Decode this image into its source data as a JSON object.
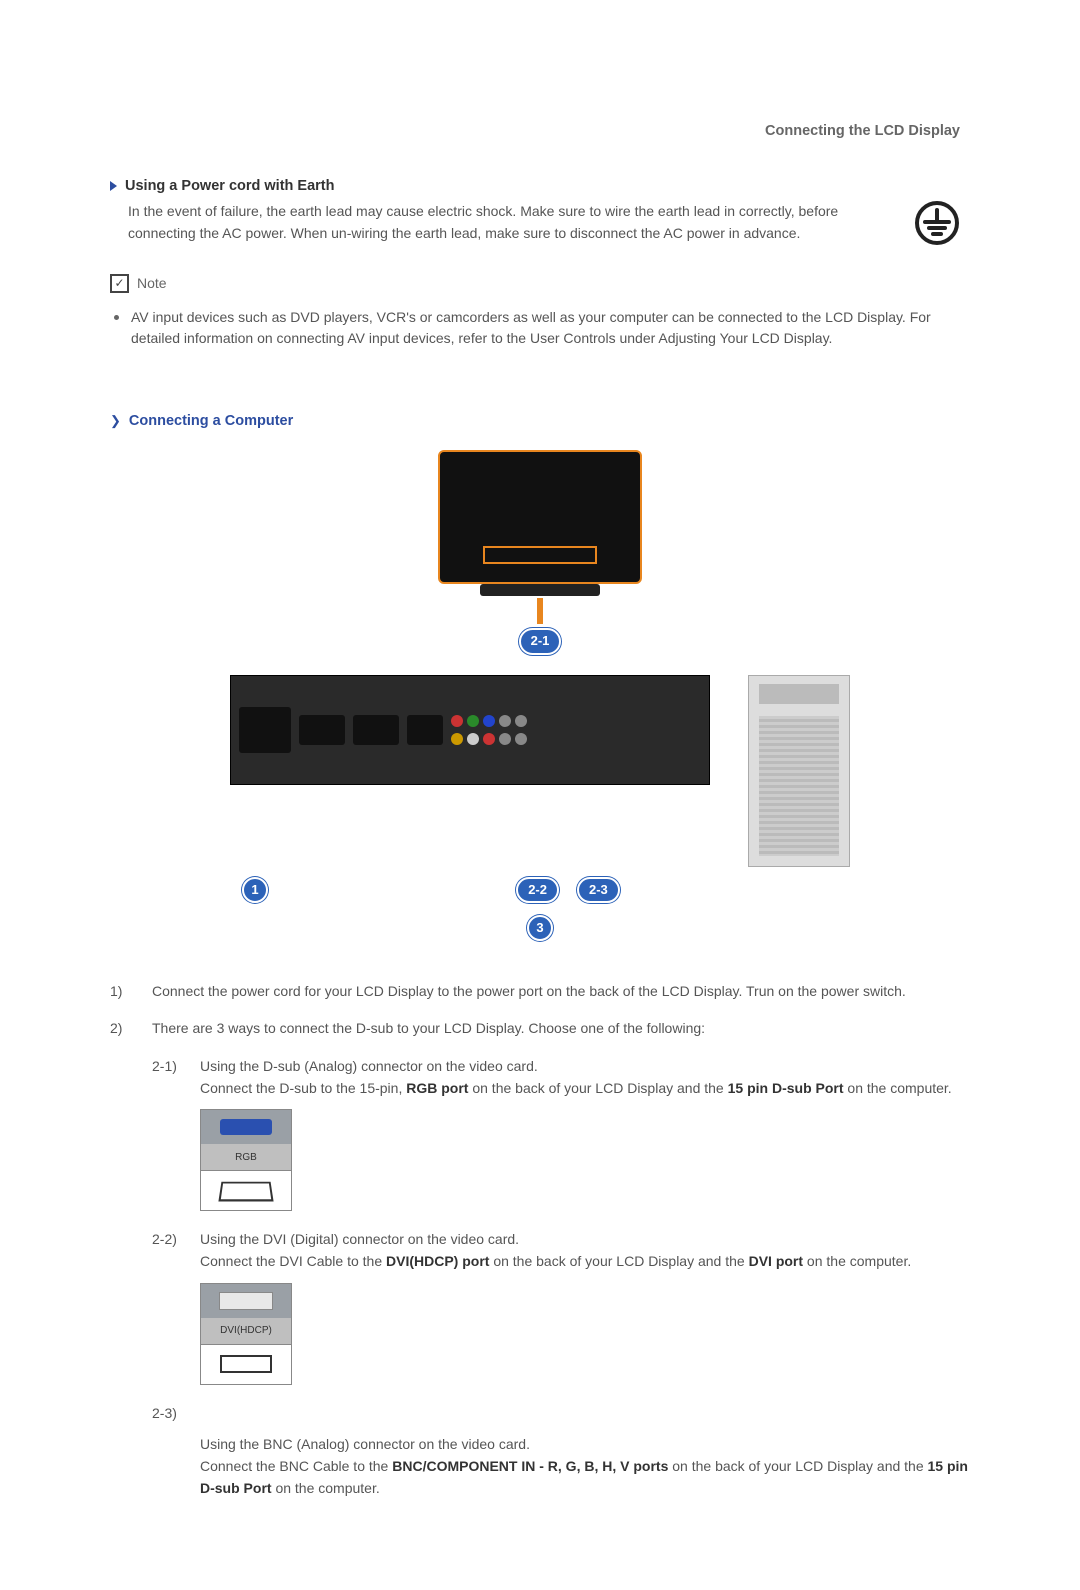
{
  "header": {
    "title": "Connecting the LCD Display"
  },
  "section_earth": {
    "title": "Using a Power cord with Earth",
    "body": "In the event of failure, the earth lead may cause electric shock. Make sure to wire the earth lead in correctly, before connecting the AC power. When un-wiring the earth lead, make sure to disconnect the AC power in advance."
  },
  "note": {
    "label": "Note",
    "body": "AV input devices such as DVD players, VCR's or camcorders as well as your computer can be connected to the LCD Display. For detailed information on connecting AV input devices, refer to the User Controls under Adjusting Your LCD Display."
  },
  "section_connect": {
    "title": "Connecting a Computer"
  },
  "callouts": {
    "c21": "2-1",
    "c22": "2-2",
    "c23": "2-3",
    "n1": "1",
    "n3": "3"
  },
  "steps": {
    "s1_n": "1)",
    "s1": "Connect the power cord for your LCD Display to the power port on the back of the LCD Display. Trun on the power switch.",
    "s2_n": "2)",
    "s2": "There are 3 ways to connect the D-sub to your LCD Display. Choose one of the following:",
    "s21_n": "2-1)",
    "s21a": "Using the D-sub (Analog) connector on the video card.",
    "s21b_pre": "Connect the D-sub to the 15-pin, ",
    "s21b_b1": "RGB port",
    "s21b_mid": " on the back of your LCD Display and the ",
    "s21b_b2": "15 pin D-sub Port",
    "s21b_post": " on the computer.",
    "s22_n": "2-2)",
    "s22a": "Using the DVI (Digital) connector on the video card.",
    "s22b_pre": "Connect the DVI Cable to the ",
    "s22b_b1": "DVI(HDCP) port",
    "s22b_mid": " on the back of your LCD Display and the ",
    "s22b_b2": "DVI port",
    "s22b_post": " on the computer.",
    "s23_n": "2-3)",
    "s23a": "Using the BNC (Analog) connector on the video card.",
    "s23b_pre": "Connect the BNC Cable to the ",
    "s23b_b1": "BNC/COMPONENT IN - R, G, B, H, V ports",
    "s23b_mid": " on the back of your LCD Display and the ",
    "s23b_b2": "15 pin D-sub Port",
    "s23b_post": " on the computer."
  },
  "port_labels": {
    "rgb": "RGB",
    "dvi": "DVI(HDCP)"
  }
}
